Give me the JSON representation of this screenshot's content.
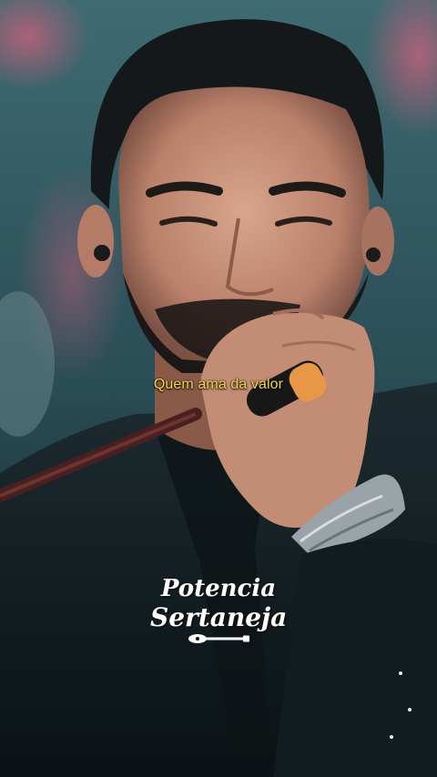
{
  "video": {
    "caption": "Quem ama da valor"
  },
  "watermark": {
    "line1": "Potencia",
    "line2": "Sertaneja",
    "icon": "guitar-icon"
  },
  "colors": {
    "caption": "#f4d64a",
    "background": "#0d1a1e"
  }
}
